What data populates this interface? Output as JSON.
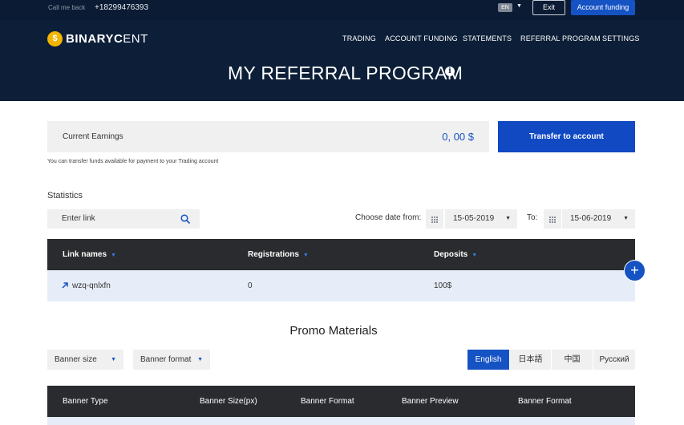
{
  "topbar": {
    "callback_label": "Call me back",
    "phone": "+18299476393",
    "language": "EN",
    "exit_label": "Exit",
    "account_funding_label": "Account funding"
  },
  "header": {
    "brand_bold": "BINARYC",
    "brand_light": "ENT",
    "coin_symbol": "$",
    "nav": [
      "TRADING",
      "ACCOUNT FUNDING",
      "STATEMENTS",
      "REFERRAL PROGRAM",
      "SETTINGS"
    ],
    "page_title": "MY REFERRAL PROGRAM"
  },
  "earnings": {
    "label": "Current Earnings",
    "value": "0, 00 $",
    "transfer_label": "Transfer to account",
    "note": "You can transfer funds available for payment to your Trading account"
  },
  "statistics": {
    "title": "Statistics",
    "search_placeholder": "Enter link",
    "date_from_label": "Choose date from:",
    "date_from": "15-05-2019",
    "date_to_label": "To:",
    "date_to": "15-06-2019",
    "columns": [
      "Link names",
      "Registrations",
      "Deposits"
    ],
    "rows": [
      {
        "link": "wzq-qnlxfn",
        "registrations": "0",
        "deposits": "100$"
      }
    ]
  },
  "promo": {
    "title": "Promo Materials",
    "banner_size_label": "Banner size",
    "banner_format_label": "Banner format",
    "languages": [
      "English",
      "日本語",
      "中国",
      "Русский"
    ],
    "active_language": "English",
    "columns": [
      "Banner Type",
      "Banner Size(px)",
      "Banner Format",
      "Banner Preview",
      "Banner Format"
    ]
  },
  "colors": {
    "header_bg": "#0d1f38",
    "accent": "#1552c4",
    "table_header": "#2a2b2e",
    "row_bg": "#e7edf8"
  }
}
